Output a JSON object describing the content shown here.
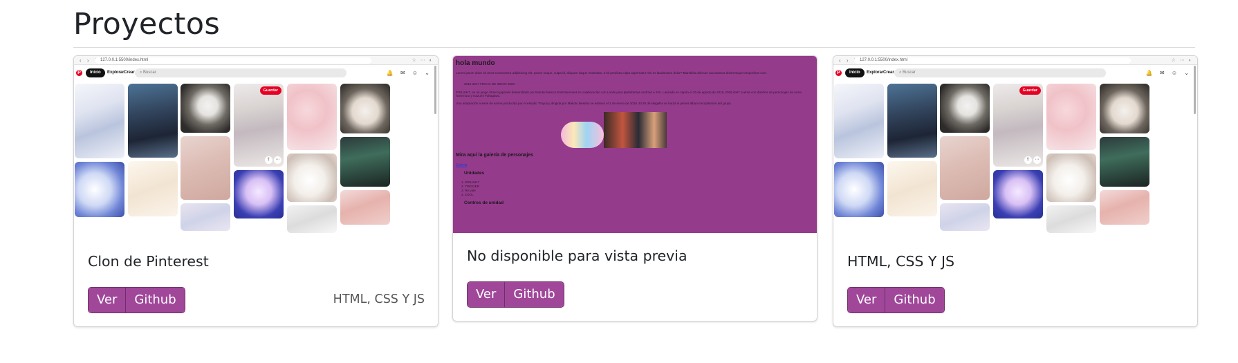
{
  "section": {
    "title": "Proyectos"
  },
  "cards": [
    {
      "title": "Clon de Pinterest",
      "buttons": {
        "view": "Ver",
        "github": "Github"
      },
      "tech": "HTML, CSS Y JS",
      "preview": {
        "url": "127.0.0.1:5500/index.html",
        "nav": {
          "home": "Inicio",
          "explore": "Explorar",
          "create": "Crear"
        },
        "search_placeholder": "Buscar",
        "save": "Guardar"
      }
    },
    {
      "title": "No disponible para vista previa",
      "buttons": {
        "view": "Ver",
        "github": "Github"
      },
      "preview": {
        "heading": "hola mundo",
        "para1": "Lorem ipsum dolor sit amet consectetur adipisicing elit. Ipsum neque, culpa id, aliquam itaque molestias, a hit predicta culpa aspernatur nisi ex laudantium dolor? Blanditiis dolorum accusamus doloremque temporibus cum.",
        "para2": "2016-2017 FECHA DE INICIO 2020",
        "para3": "IDOLiSH7, es un juego rítmico japonés desarrollado por Bandai Namco Entertainment en colaboración con Lantis para plataformas Android e iOS. Lanzado en Japón el 20 de agosto de 2015, IDOLiSH7 cuenta con diseños de personajes de Arina Tanemura y Kazumi Fukagawa.",
        "para4": "Una adaptación a serie de anime producida por el estudio Troyca y dirigida por Makoto Bessho se estrenó el 1 de enero de 2018. El 26 de MagaPa se lanzó el primer álbum recopilatorio del grupo.",
        "gallery_heading": "Mira aquí la galería de personajes",
        "link": "Galería",
        "units_heading": "Unidades",
        "units": [
          "IDOLiSH7",
          "TRIGGER",
          "Re:vale",
          "ZOOL"
        ],
        "centers_heading": "Centros de unidad"
      }
    },
    {
      "title": "HTML, CSS Y JS",
      "buttons": {
        "view": "Ver",
        "github": "Github"
      },
      "preview": {
        "url": "127.0.0.1:5500/index.html",
        "nav": {
          "home": "Inicio",
          "explore": "Explorar",
          "create": "Crear"
        },
        "search_placeholder": "Buscar",
        "save": "Guardar"
      }
    }
  ],
  "colors": {
    "button_bg": "#a0479a",
    "preview_purple": "#953b8c",
    "pinterest_red": "#e60023"
  }
}
